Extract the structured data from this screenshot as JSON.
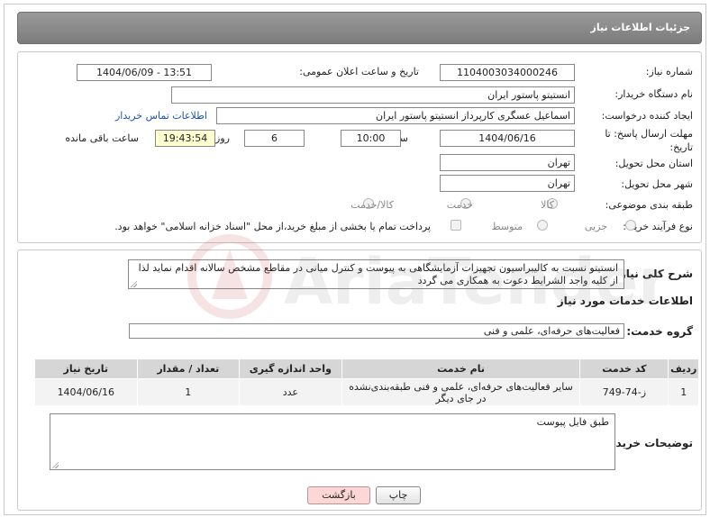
{
  "header": {
    "title": "جزئیات اطلاعات نیاز"
  },
  "form": {
    "need_number": {
      "label": "شماره نیاز:",
      "value": "1104003034000246"
    },
    "announce_datetime": {
      "label": "تاریخ و ساعت اعلان عمومی:",
      "value": "1404/06/09 - 13:51"
    },
    "buyer_org": {
      "label": "نام دستگاه خریدار:",
      "value": "انستیتو پاستور ایران"
    },
    "requester": {
      "label": "ایجاد کننده درخواست:",
      "value": "اسماعیل عسگری کارپرداز انستیتو پاستور ایران",
      "contact_link": "اطلاعات تماس خریدار"
    },
    "deadline": {
      "label_line1": "مهلت ارسال پاسخ: تا",
      "label_line2": "تاریخ:",
      "date": "1404/06/16",
      "time_label": "ساعت",
      "time": "10:00",
      "days": "6",
      "days_label": "روز و",
      "remaining": "19:43:54",
      "remaining_label": "ساعت باقی مانده"
    },
    "delivery_province": {
      "label": "استان محل تحویل:",
      "value": "تهران"
    },
    "delivery_city": {
      "label": "شهر محل تحویل:",
      "value": "تهران"
    },
    "category": {
      "label": "طبقه بندی موضوعی:",
      "options": [
        "کالا",
        "خدمت",
        "کالا/خدمت"
      ]
    },
    "process": {
      "label": "نوع فرآیند خرید :",
      "options": [
        "جزیی",
        "متوسط"
      ],
      "payment_note": "پرداخت تمام یا بخشی از مبلغ خرید،از محل \"اسناد خزانه اسلامی\" خواهد بود."
    }
  },
  "description": {
    "label": "شرح کلی نیاز:",
    "text": "انستیتو نسبت به کالیبراسیون تجهیزات آزمایشگاهی به پیوست و کنترل میانی در مقاطع مشخص سالانه اقدام نماید لذا از کلیه واجد الشرایط دعوت به همکاری می گردد"
  },
  "services": {
    "section_title": "اطلاعات خدمات مورد نیاز",
    "group_label": "گروه خدمت:",
    "group_value": "فعالیت‌های حرفه‌ای، علمی و فنی",
    "columns": [
      "ردیف",
      "کد خدمت",
      "نام خدمت",
      "واحد اندازه گیری",
      "تعداد / مقدار",
      "تاریخ نیاز"
    ],
    "rows": [
      {
        "row": "1",
        "code": "ز-74-749",
        "name": "سایر فعالیت‌های حرفه‌ای، علمی و فنی طبقه‌بندی‌نشده در جای دیگر",
        "unit": "عدد",
        "qty": "1",
        "date": "1404/06/16"
      }
    ]
  },
  "buyer_notes": {
    "label": "توضیحات خریدار:",
    "text": "طبق فایل پیوست"
  },
  "buttons": {
    "print": "چاپ",
    "back": "بازگشت"
  },
  "watermark": {
    "text": "AriaTender.neT"
  },
  "colors": {
    "header_bg": "#8a8a8a",
    "link": "#1a55b0",
    "back_button": "#fdd6d6",
    "remaining_bg": "#ffffd0"
  }
}
